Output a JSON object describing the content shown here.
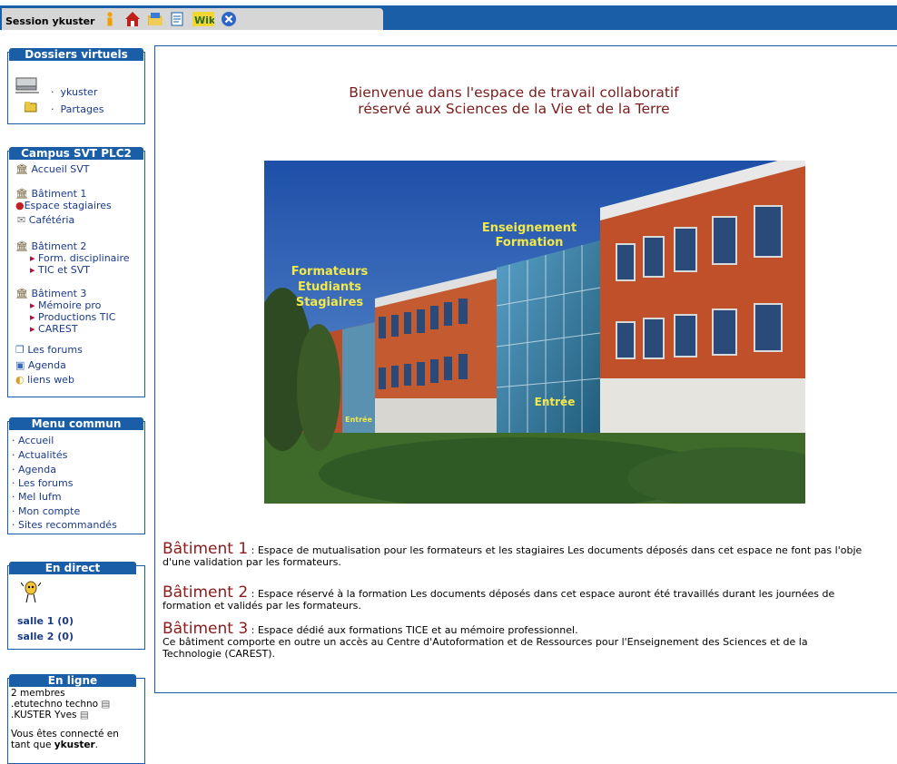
{
  "topbar": {
    "session_label": "Session ykuster",
    "icons": [
      "info-icon",
      "home-icon",
      "folder-icon",
      "document-icon",
      "wiki-icon",
      "close-icon"
    ]
  },
  "dossiers": {
    "title": "Dossiers virtuels",
    "items": [
      "ykuster",
      "Partages"
    ]
  },
  "campus": {
    "title": "Campus SVT PLC2",
    "accueil": "Accueil SVT",
    "bat1": "Bâtiment 1",
    "espace": "Espace stagiaires",
    "cafe": "Cafétéria",
    "bat2": "Bâtiment 2",
    "form": "Form. disciplinaire",
    "tic": "TIC et SVT",
    "bat3": "Bâtiment 3",
    "memoire": "Mémoire pro",
    "prod": "Productions TIC",
    "carest": "CAREST",
    "forums": "Les forums",
    "agenda": "Agenda",
    "liens": "liens web"
  },
  "menu": {
    "title": "Menu commun",
    "items": [
      "Accueil",
      "Actualités",
      "Agenda",
      "Les forums",
      "Mel Iufm",
      "Mon compte",
      "Sites recommandés"
    ]
  },
  "direct": {
    "title": "En direct",
    "salle1": "salle 1 (0)",
    "salle2": "salle 2 (0)"
  },
  "enligne": {
    "title": "En ligne",
    "count": "2 membres",
    "m1": ".etutechno techno",
    "m2": ".KUSTER Yves",
    "conn1": "Vous êtes connecté en",
    "conn2": "tant que",
    "user": "ykuster",
    "dot": "."
  },
  "main": {
    "welcome1": "Bienvenue dans l'espace de travail collaboratif",
    "welcome2": "réservé aux Sciences de la Vie et de la Terre",
    "photo_labels": {
      "ens1": "Enseignement",
      "ens2": "Formation",
      "f1": "Formateurs",
      "f2": "Etudiants",
      "f3": "Stagiaires",
      "entree": "Entrée",
      "entree_small": "Entrée"
    },
    "b1_title": "Bâtiment 1",
    "b1_text1": " : Espace de mutualisation pour les formateurs et les stagiaires Les documents déposés dans cet espace ne font pas l'obje",
    "b1_text2": "d'une validation par les formateurs.",
    "b2_title": "Bâtiment 2",
    "b2_text1": " : Espace réservé à la formation Les documents déposés dans cet espace auront été travaillés durant les journées de",
    "b2_text2": "formation et validés par les formateurs.",
    "b3_title": "Bâtiment 3",
    "b3_text1": " : Espace dédié aux formations TICE et au mémoire professionnel.",
    "b3_text2": "Ce bâtiment comporte en outre un accès au Centre d'Autoformation et de Ressources pour l'Enseignement des Sciences  et de la",
    "b3_text3": "Technologie (CAREST)."
  }
}
